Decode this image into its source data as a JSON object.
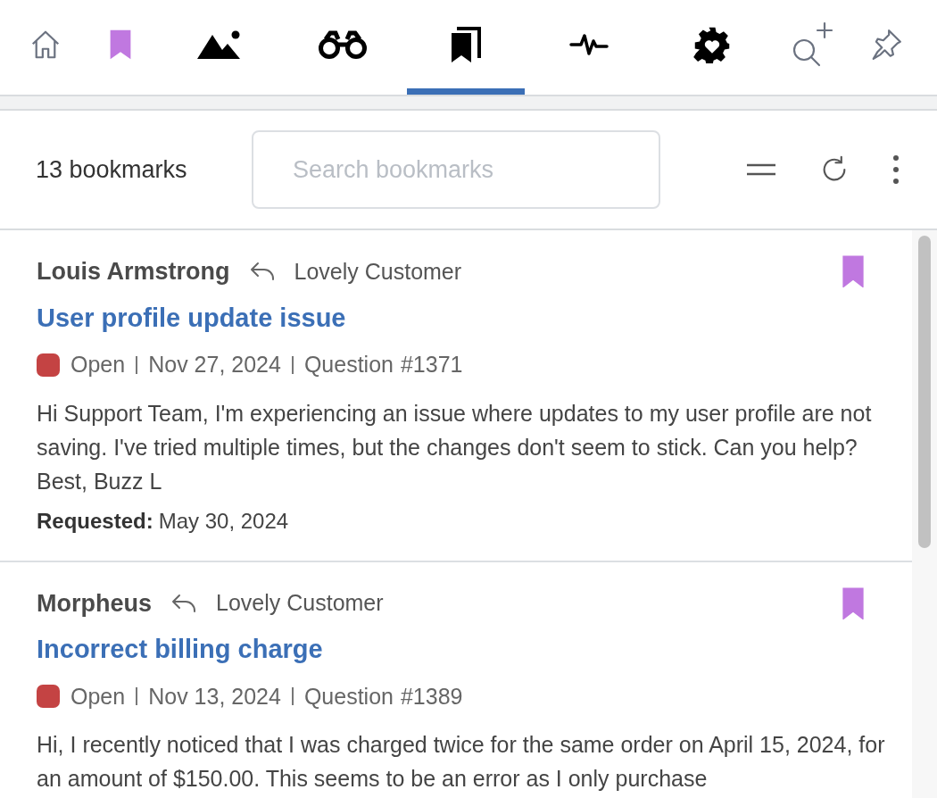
{
  "toolbar": {
    "tabs": [
      {
        "kind": "home",
        "selected": false
      },
      {
        "kind": "bookmark",
        "selected": false
      },
      {
        "kind": "image",
        "selected": false
      },
      {
        "kind": "binoculars",
        "selected": false
      },
      {
        "kind": "bookmarks",
        "selected": true
      },
      {
        "kind": "activity",
        "selected": false
      },
      {
        "kind": "gear-heart",
        "selected": false
      },
      {
        "kind": "search-plus",
        "selected": false
      },
      {
        "kind": "pin",
        "selected": false
      }
    ]
  },
  "header": {
    "count": "13 bookmarks",
    "search": {
      "placeholder": "Search bookmarks"
    }
  },
  "items": [
    {
      "author": "Louis Armstrong",
      "role": "Lovely Customer",
      "title": "User profile update issue",
      "status": "Open",
      "color": "#c44343",
      "date": "Nov 27, 2024",
      "type": "Question",
      "number": "#1371",
      "body": "Hi Support Team, I'm experiencing an issue where updates to my user profile are not saving. I've tried multiple times, but the changes don't seem to stick. Can you help? Best, Buzz L",
      "requested_label": "Requested:",
      "requested_date": "May 30, 2024",
      "bookmarked": true
    },
    {
      "author": "Morpheus",
      "role": "Lovely Customer",
      "title": "Incorrect billing charge",
      "status": "Open",
      "color": "#c44343",
      "date": "Nov 13, 2024",
      "type": "Question",
      "number": "#1389",
      "body": "Hi, I recently noticed that I was charged twice for the same order on April 15, 2024, for an amount of $150.00. This seems to be an error as I only purchase",
      "bookmarked": true
    }
  ]
}
